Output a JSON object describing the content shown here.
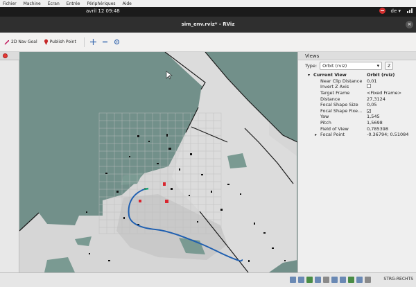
{
  "vm_menu": [
    "Fichier",
    "Machine",
    "Écran",
    "Entrée",
    "Périphériques",
    "Aide"
  ],
  "topbar": {
    "clock": "avril 12  09:48",
    "language": "de ▾"
  },
  "window": {
    "title": "sim_env.rviz* - RViz"
  },
  "toolbar": {
    "nav_goal_label": "2D Nav Goal",
    "publish_point_label": "Publish Point"
  },
  "views": {
    "panel_title": "Views",
    "type_label": "Type:",
    "type_value": "Orbit (rviz)",
    "zero_label": "Z",
    "current_view_label": "Current View",
    "current_view_value": "Orbit (rviz)",
    "properties": [
      {
        "key": "Near Clip Distance",
        "value": "0,01"
      },
      {
        "key": "Invert Z Axis",
        "value": ""
      },
      {
        "key": "Target Frame",
        "value": "<Fixed Frame>"
      },
      {
        "key": "Distance",
        "value": "27,3124"
      },
      {
        "key": "Focal Shape Size",
        "value": "0,05"
      },
      {
        "key": "Focal Shape Fixe...",
        "value": "✓"
      },
      {
        "key": "Yaw",
        "value": "1,545"
      },
      {
        "key": "Pitch",
        "value": "1,5698"
      },
      {
        "key": "Field of View",
        "value": "0,785398"
      },
      {
        "key": "Focal Point",
        "value": "-0.36794; 0.51084"
      }
    ]
  },
  "status": {
    "host_key": "STRG-RECHTS"
  },
  "colors": {
    "map_unknown": "#72908a",
    "map_free": "#d8d8d8",
    "path_line": "#1f5fb0",
    "obstacle": "#111111",
    "goal_marker": "#d9262f"
  }
}
